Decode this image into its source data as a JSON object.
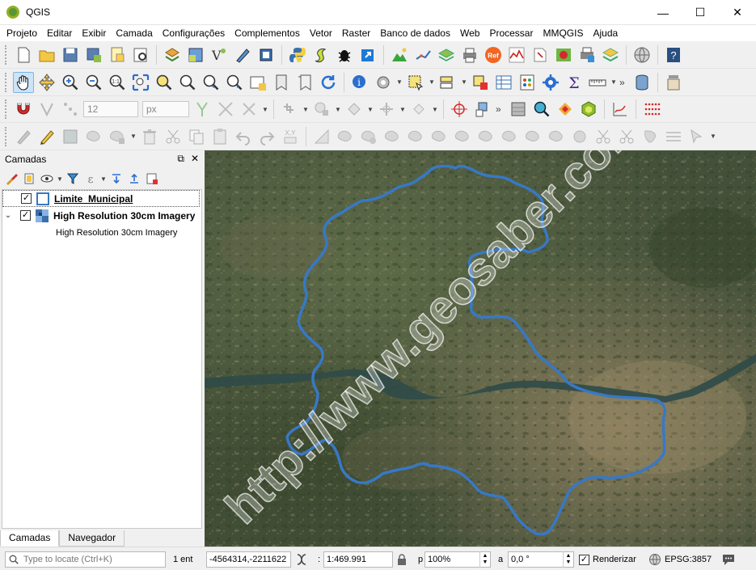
{
  "window": {
    "title": "QGIS",
    "minimize": "—",
    "maximize": "☐",
    "close": "✕"
  },
  "menu": [
    "Projeto",
    "Editar",
    "Exibir",
    "Camada",
    "Configurações",
    "Complementos",
    "Vetor",
    "Raster",
    "Banco de dados",
    "Web",
    "Processar",
    "MMQGIS",
    "Ajuda"
  ],
  "toolbars": {
    "digitizing_width_value": "12",
    "digitizing_units": "px",
    "ref_badge": "Ref"
  },
  "layers_panel": {
    "title": "Camadas",
    "float_icon": "⧉",
    "close_icon": "✕",
    "layers": [
      {
        "name": "Limite_Municipal",
        "checked": true,
        "selected": true,
        "icon": "polygon-layer-icon"
      },
      {
        "name": "High Resolution 30cm Imagery",
        "checked": true,
        "expanded": true,
        "icon": "raster-layer-icon",
        "legend": "High Resolution 30cm Imagery"
      }
    ],
    "check_mark": "✓",
    "expander": "⌄",
    "tabs": [
      "Camadas",
      "Navegador"
    ]
  },
  "map": {
    "watermark": "http://www.geosaber.com",
    "boundary_color": "#3878c5"
  },
  "statusbar": {
    "search_placeholder": "Type to locate (Ctrl+K)",
    "messages_label": "1 ent",
    "coordinate": "-4564314,-2211622",
    "scale_label": ":",
    "scale": "1:469.991",
    "magnifier_label": "p",
    "magnifier": "100%",
    "rotation_label": "a",
    "rotation": "0,0 °",
    "render_label": "Renderizar",
    "render_checked": true,
    "crs": "EPSG:3857"
  }
}
